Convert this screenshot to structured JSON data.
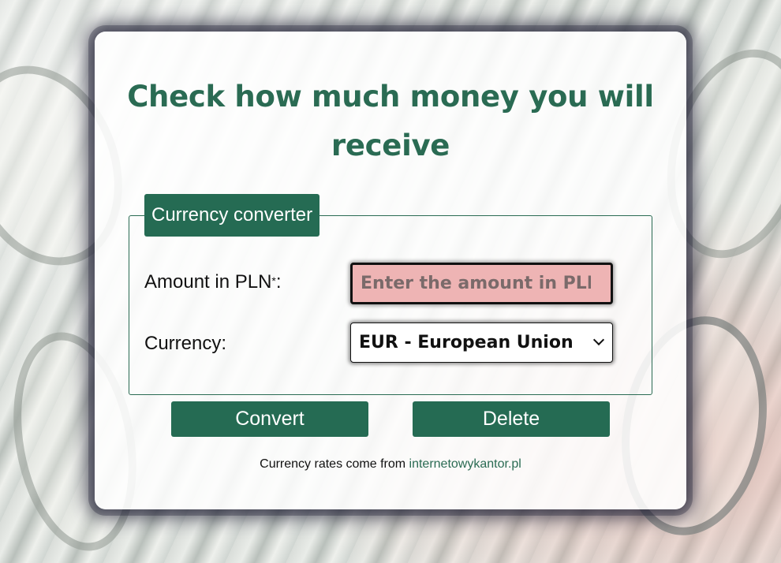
{
  "page": {
    "title": "Check how much money you will receive"
  },
  "form": {
    "legend": "Currency converter",
    "amount_label": "Amount in PLN",
    "required_mark": "*",
    "amount_label_suffix": ":",
    "amount_placeholder": "Enter the amount in PLN",
    "amount_value": "",
    "currency_label": "Currency:",
    "currency_selected": "EUR - European Union",
    "convert_button": "Convert",
    "delete_button": "Delete"
  },
  "footer": {
    "text": "Currency rates come from",
    "link_text": "internetowykantor.pl"
  },
  "colors": {
    "accent": "#256b53",
    "title": "#2a6b53",
    "input_invalid_bg": "#eeb4b4"
  },
  "icons": {
    "select_arrow": "chevron-down-icon"
  }
}
